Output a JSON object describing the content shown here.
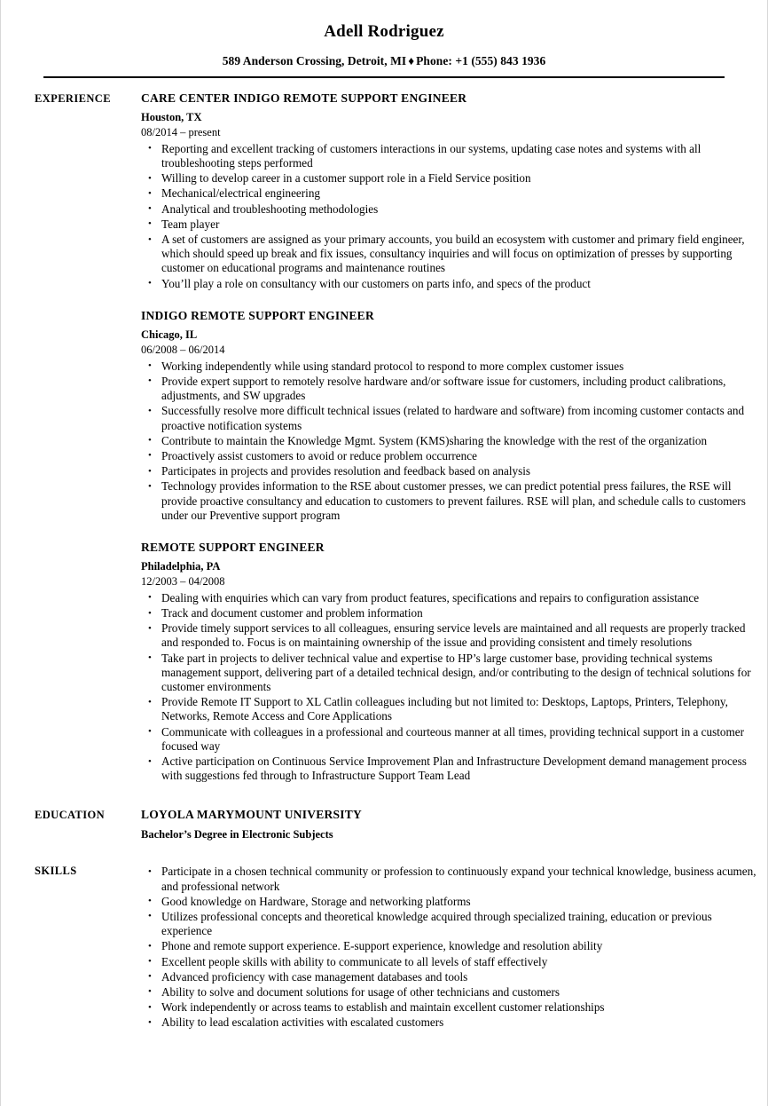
{
  "header": {
    "name": "Adell Rodriguez",
    "address": "589 Anderson Crossing, Detroit, MI",
    "separator": "♦",
    "phone": "Phone: +1 (555) 843 1936"
  },
  "sections": {
    "experience_label": "EXPERIENCE",
    "education_label": "EDUCATION",
    "skills_label": "SKILLS"
  },
  "experience": {
    "jobs": [
      {
        "title": "CARE CENTER INDIGO REMOTE SUPPORT ENGINEER",
        "location": "Houston, TX",
        "dates": "08/2014 – present",
        "bullets": [
          "Reporting and excellent tracking of customers interactions in our systems, updating case notes and systems with all troubleshooting steps performed",
          "Willing to develop career in a customer support role in a Field Service position",
          "Mechanical/electrical engineering",
          "Analytical and troubleshooting methodologies",
          "Team player",
          "A set of customers are assigned as your primary accounts, you build an ecosystem with customer and primary field engineer, which should speed up break and fix issues, consultancy inquiries and will focus on optimization of presses by supporting customer on educational programs and maintenance routines",
          "You’ll play a role on consultancy with our customers on parts info, and specs of the product"
        ]
      },
      {
        "title": "INDIGO REMOTE SUPPORT ENGINEER",
        "location": "Chicago, IL",
        "dates": "06/2008 – 06/2014",
        "bullets": [
          "Working independently while using standard protocol to respond to more complex customer issues",
          "Provide expert support to remotely resolve hardware and/or software issue for customers, including product calibrations, adjustments, and SW upgrades",
          "Successfully resolve more difficult technical issues (related to hardware and software) from incoming customer contacts and proactive notification systems",
          "Contribute to maintain the Knowledge Mgmt. System (KMS)sharing the knowledge with the rest of the organization",
          "Proactively assist customers to avoid or reduce problem occurrence",
          "Participates in projects and provides resolution and feedback based on analysis",
          "Technology provides information to the RSE about customer presses, we can predict potential press failures, the RSE will provide proactive consultancy and education to customers to prevent failures. RSE will plan, and schedule calls to customers under our Preventive support program"
        ]
      },
      {
        "title": "REMOTE SUPPORT ENGINEER",
        "location": "Philadelphia, PA",
        "dates": "12/2003 – 04/2008",
        "bullets": [
          "Dealing with enquiries which can vary from product features, specifications and repairs to configuration assistance",
          "Track and document customer and problem information",
          "Provide timely support services to all colleagues, ensuring service levels are maintained and all requests are properly tracked and responded to. Focus is on maintaining ownership of the issue and providing consistent and timely resolutions",
          "Take part in projects to deliver technical value and expertise to HP’s large customer base, providing technical systems management support, delivering part of a detailed technical design, and/or contributing to the design of technical solutions for customer environments",
          "Provide Remote IT Support to XL Catlin colleagues including but not limited to: Desktops, Laptops, Printers, Telephony, Networks, Remote Access and Core Applications",
          "Communicate with colleagues in a professional and courteous manner at all times, providing technical support in a customer focused way",
          "Active participation on Continuous Service Improvement Plan and Infrastructure Development demand management process with suggestions fed through to Infrastructure Support Team Lead"
        ]
      }
    ]
  },
  "education": {
    "school": "LOYOLA MARYMOUNT UNIVERSITY",
    "degree": "Bachelor’s Degree in Electronic Subjects"
  },
  "skills": {
    "bullets": [
      "Participate in a chosen technical community or profession to continuously expand your technical knowledge, business acumen, and professional network",
      "Good knowledge on Hardware, Storage and networking platforms",
      "Utilizes professional concepts and theoretical knowledge acquired through specialized training, education or previous experience",
      "Phone and remote support experience. E-support experience, knowledge and resolution ability",
      "Excellent people skills with ability to communicate to all levels of staff effectively",
      "Advanced proficiency with case management databases and tools",
      "Ability to solve and document solutions for usage of other technicians and customers",
      "Work independently or across teams to establish and maintain excellent customer relationships",
      "Ability to lead escalation activities with escalated customers"
    ]
  }
}
